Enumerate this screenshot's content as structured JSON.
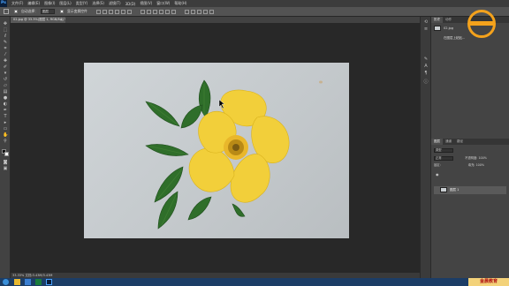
{
  "app": {
    "logo_text": "Ps",
    "menus": [
      "文件(F)",
      "编辑(E)",
      "图像(I)",
      "图层(L)",
      "类型(Y)",
      "选择(S)",
      "滤镜(T)",
      "3D(D)",
      "视图(V)",
      "窗口(W)",
      "帮助(H)"
    ]
  },
  "options_bar": {
    "auto_select_label": "自动选择：",
    "auto_select_value": "图层",
    "show_transform_label": "显示变换控件"
  },
  "document": {
    "tab_title": "02.jpg @ 33.3%(图层 1, RGB/8#) *",
    "tab_close": "×"
  },
  "status_bar": {
    "text": "33.33%    文档:3.43M/3.43M"
  },
  "panels": {
    "history_tabs": [
      "历史",
      "动作"
    ],
    "history_items": [
      "02.jpg",
      "在图层上粘贴..."
    ],
    "layers_tabs": [
      "图层",
      "通道",
      "路径"
    ],
    "kind_label": "类型",
    "blend_mode": "正常",
    "opacity_label": "不透明度:",
    "opacity_value": "100%",
    "lock_label": "锁定:",
    "fill_label": "填充:",
    "fill_value": "100%",
    "layer_name": "图层 1"
  },
  "watermark": {
    "text": "金晨教育"
  },
  "colors": {
    "accent": "#f4a21c",
    "petal": "#f2cf3a",
    "leaf": "#2f6e2a",
    "taskbar": "#1c3d66"
  },
  "icons": [
    "move-icon",
    "marquee-icon",
    "lasso-icon",
    "quick-select-icon",
    "crop-icon",
    "eyedropper-icon",
    "healing-icon",
    "brush-icon",
    "stamp-icon",
    "history-brush-icon",
    "eraser-icon",
    "gradient-icon",
    "blur-icon",
    "dodge-icon",
    "pen-icon",
    "type-icon",
    "path-select-icon",
    "shape-icon",
    "hand-icon",
    "zoom-icon"
  ]
}
